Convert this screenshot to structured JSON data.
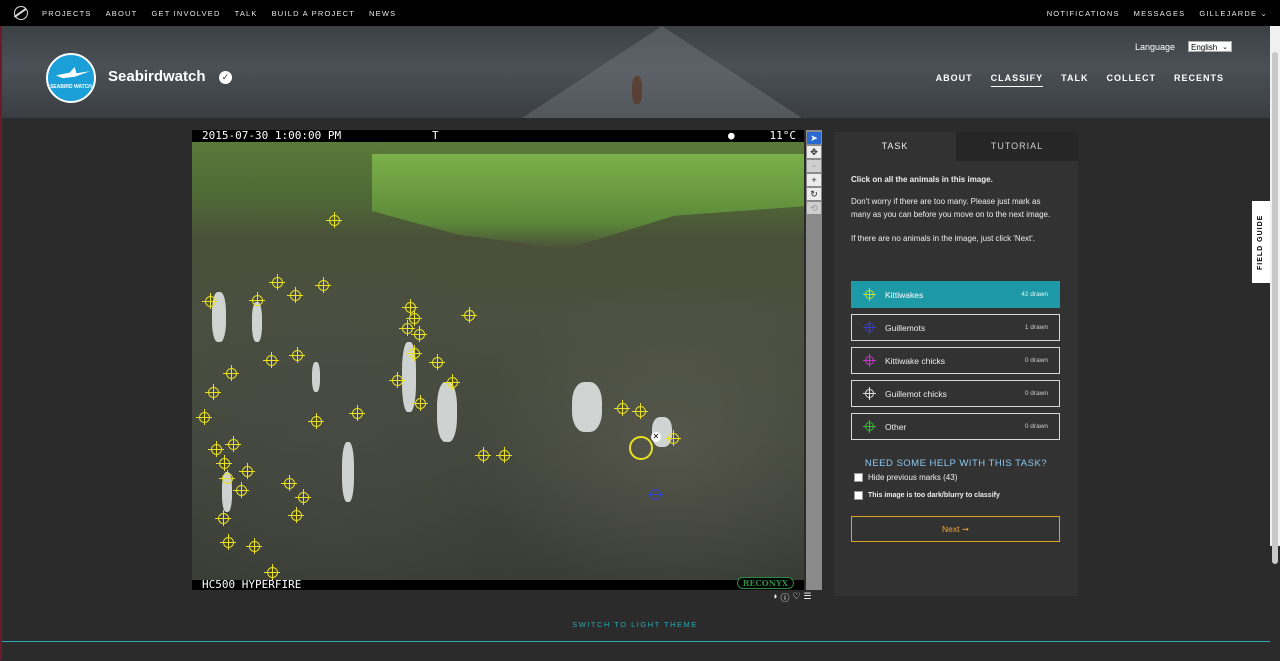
{
  "topnav": {
    "links": [
      "PROJECTS",
      "ABOUT",
      "GET INVOLVED",
      "TALK",
      "BUILD A PROJECT",
      "NEWS"
    ],
    "right": [
      "NOTIFICATIONS",
      "MESSAGES",
      "GILLEJARDE"
    ]
  },
  "header": {
    "logo_text": "SEABIRD WATCH",
    "title": "Seabirdwatch",
    "language_label": "Language",
    "language_value": "English",
    "nav": [
      "ABOUT",
      "CLASSIFY",
      "TALK",
      "COLLECT",
      "RECENTS"
    ],
    "active_nav": "CLASSIFY"
  },
  "subject": {
    "timestamp": "2015-07-30 1:00:00 PM",
    "channel": "T",
    "temperature": "11°C",
    "camera": "HC500 HYPERFIRE",
    "brand": "RECONYX"
  },
  "task": {
    "tabs": {
      "task": "TASK",
      "tutorial": "TUTORIAL"
    },
    "question": "Click on all the animals in this image.",
    "instruction1": "Don't worry if there are too many. Please just mark as many as you can before you move on to the next image.",
    "instruction2": "If there are no animals in the image, just click 'Next'.",
    "tools": [
      {
        "label": "Kittiwakes",
        "count": "42 drawn",
        "color": "#c8e020"
      },
      {
        "label": "Guillemots",
        "count": "1 drawn",
        "color": "#2a2ad0"
      },
      {
        "label": "Kittiwake chicks",
        "count": "0 drawn",
        "color": "#d030d0"
      },
      {
        "label": "Guillemot chicks",
        "count": "0 drawn",
        "color": "#e0e0e0"
      },
      {
        "label": "Other",
        "count": "0 drawn",
        "color": "#30c030"
      }
    ],
    "help": "NEED SOME HELP WITH THIS TASK?",
    "hide_marks": "Hide previous marks (43)",
    "too_dark": "This image is too dark/blurry to classify",
    "next": "Next ➞"
  },
  "field_guide": "FIELD GUIDE",
  "theme_toggle": "SWITCH TO LIGHT THEME"
}
